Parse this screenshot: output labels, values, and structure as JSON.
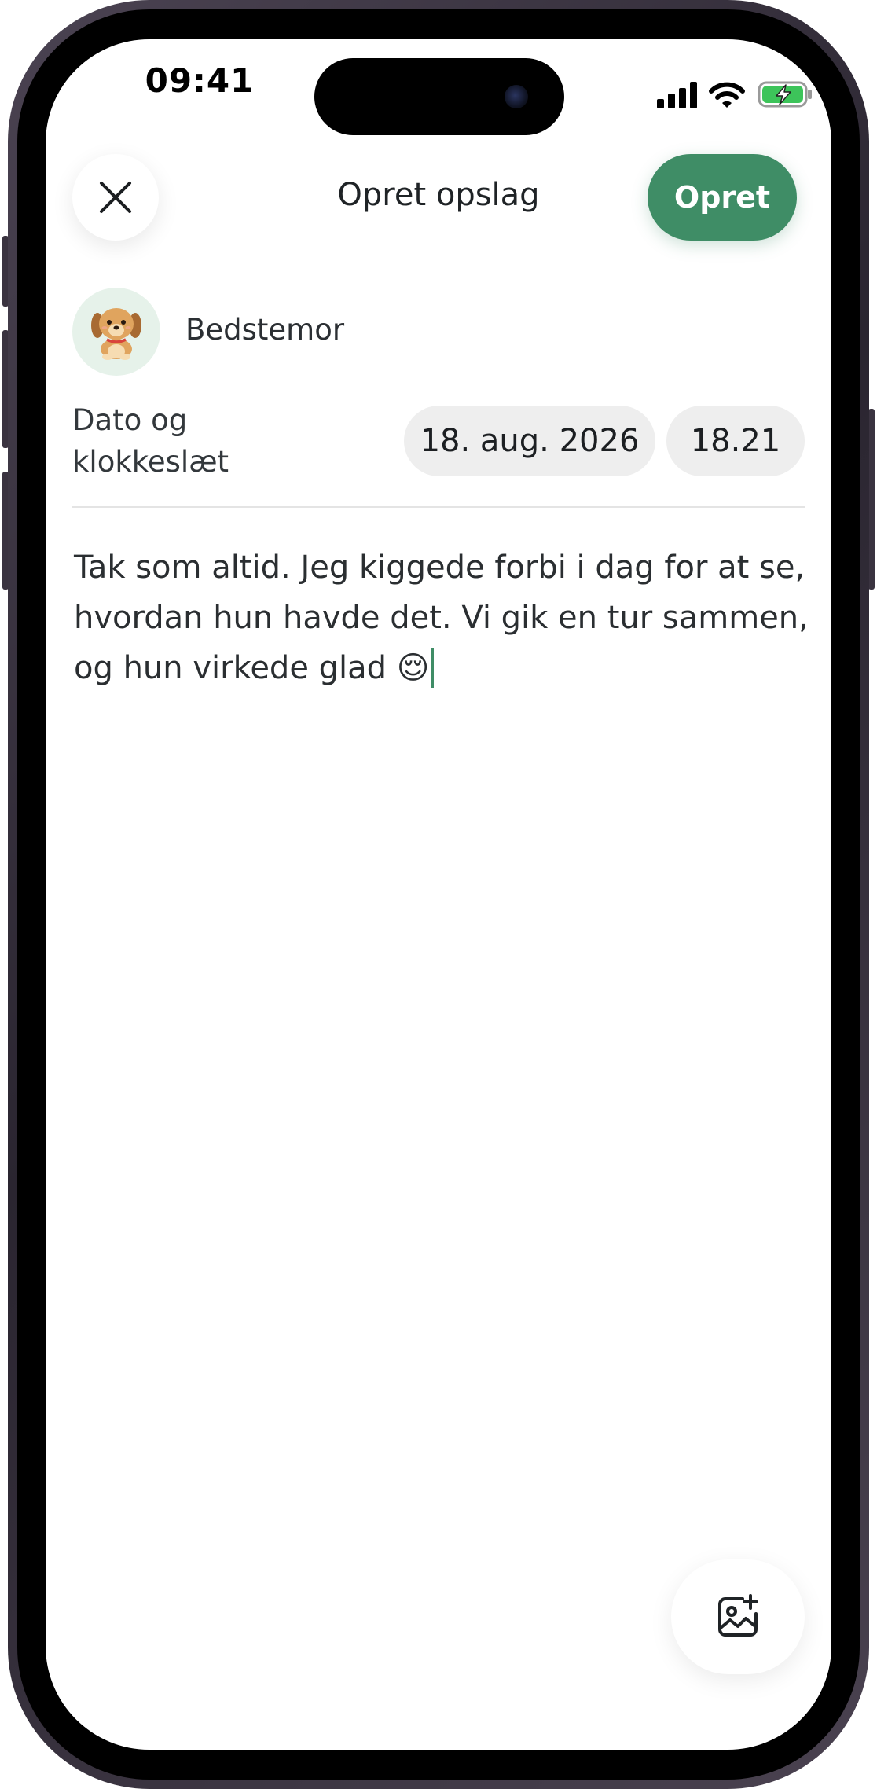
{
  "status_bar": {
    "time": "09:41",
    "icons": [
      "cellular-signal-icon",
      "wifi-icon",
      "battery-charging-icon"
    ]
  },
  "header": {
    "close_icon": "close-icon",
    "title": "Opret opslag",
    "create_label": "Opret"
  },
  "author": {
    "avatar_icon": "puppy-avatar-icon",
    "name": "Bedstemor"
  },
  "datetime": {
    "label": "Dato og klokkeslæt",
    "date": "18. aug. 2026",
    "time": "18.21"
  },
  "post": {
    "text": "Tak som altid. Jeg kiggede forbi i dag for at se, hvordan hun havde det. Vi gik en tur sammen, og hun virkede glad 😌"
  },
  "add_image_icon": "add-photo-icon",
  "colors": {
    "accent": "#3f8d66",
    "pill_bg": "#eeeeee",
    "avatar_bg": "#e6f2ea",
    "battery": "#3dc45a"
  }
}
